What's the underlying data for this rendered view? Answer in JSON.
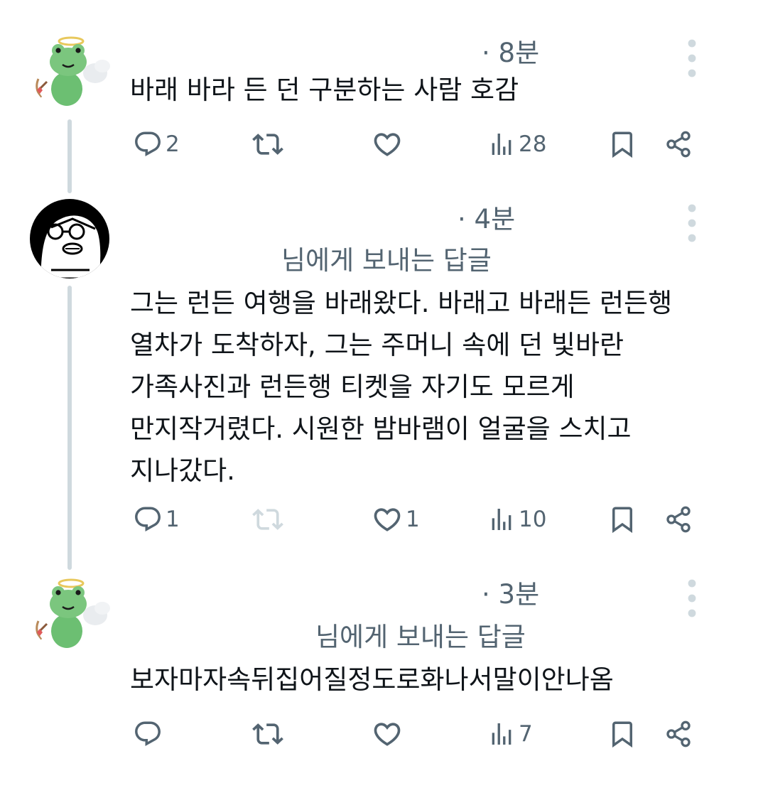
{
  "tweets": [
    {
      "time": "· 8분",
      "reply_to": "",
      "text_lines": [
        "바래 바라 든 던 구분하는 사람 호감"
      ],
      "replies": "2",
      "retweets": "",
      "likes": "",
      "views": "28"
    },
    {
      "time": "· 4분",
      "reply_to": "님에게 보내는 답글",
      "text_lines": [
        "그는 런든 여행을 바래왔다. 바래고 바래든 런든행",
        "열차가 도착하자, 그는 주머니 속에 던 빛바란",
        "가족사진과 런든행 티켓을 자기도 모르게",
        "만지작거렸다. 시원한 밤바램이 얼굴을 스치고",
        "지나갔다."
      ],
      "replies": "1",
      "retweets": "",
      "likes": "1",
      "views": "10"
    },
    {
      "time": "· 3분",
      "reply_to": "님에게 보내는 답글",
      "text_lines": [
        "보자마자속뒤집어질정도로화나서말이안나옴"
      ],
      "replies": "",
      "retweets": "",
      "likes": "",
      "views": "7"
    }
  ],
  "colors": {
    "text": "#0f1419",
    "secondary": "#536471",
    "thread_line": "#cfd9de",
    "retweet_disabled": "#cfd9de",
    "frog_green": "#7bc67e"
  },
  "icons": [
    "reply-icon",
    "retweet-icon",
    "like-icon",
    "views-icon",
    "bookmark-icon",
    "share-icon",
    "more-icon"
  ]
}
